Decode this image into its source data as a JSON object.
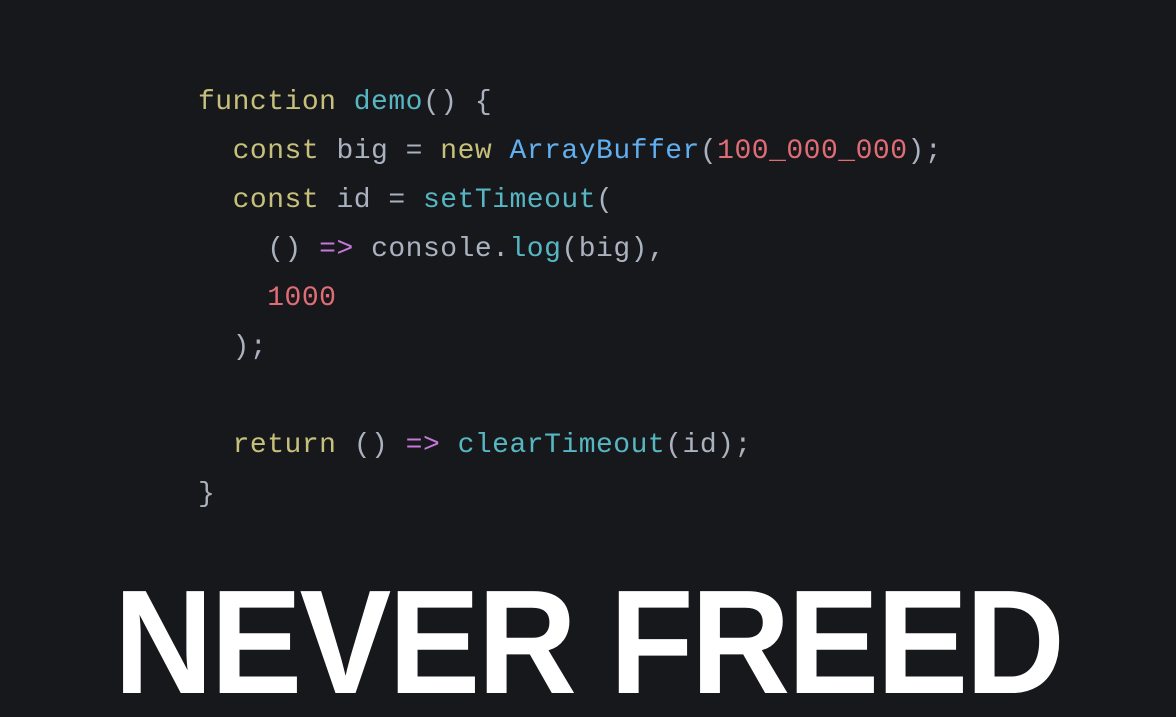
{
  "code": {
    "lines": [
      {
        "indent": 0,
        "tokens": [
          {
            "t": "function ",
            "c": "tok-keyword"
          },
          {
            "t": "demo",
            "c": "tok-func-name"
          },
          {
            "t": "() {",
            "c": "tok-punct"
          }
        ]
      },
      {
        "indent": 1,
        "tokens": [
          {
            "t": "const ",
            "c": "tok-keyword"
          },
          {
            "t": "big",
            "c": "tok-var-decl"
          },
          {
            "t": " ",
            "c": "tok-punct"
          },
          {
            "t": "=",
            "c": "tok-operator"
          },
          {
            "t": " ",
            "c": "tok-punct"
          },
          {
            "t": "new ",
            "c": "tok-keyword"
          },
          {
            "t": "ArrayBuffer",
            "c": "tok-class"
          },
          {
            "t": "(",
            "c": "tok-punct"
          },
          {
            "t": "100_000_000",
            "c": "tok-number"
          },
          {
            "t": ");",
            "c": "tok-punct"
          }
        ]
      },
      {
        "indent": 1,
        "tokens": [
          {
            "t": "const ",
            "c": "tok-keyword"
          },
          {
            "t": "id",
            "c": "tok-var-decl"
          },
          {
            "t": " ",
            "c": "tok-punct"
          },
          {
            "t": "=",
            "c": "tok-operator"
          },
          {
            "t": " ",
            "c": "tok-punct"
          },
          {
            "t": "setTimeout",
            "c": "tok-call"
          },
          {
            "t": "(",
            "c": "tok-punct"
          }
        ]
      },
      {
        "indent": 2,
        "tokens": [
          {
            "t": "() ",
            "c": "tok-punct"
          },
          {
            "t": "=>",
            "c": "tok-arrow"
          },
          {
            "t": " ",
            "c": "tok-punct"
          },
          {
            "t": "console",
            "c": "tok-object"
          },
          {
            "t": ".",
            "c": "tok-punct"
          },
          {
            "t": "log",
            "c": "tok-call"
          },
          {
            "t": "(",
            "c": "tok-punct"
          },
          {
            "t": "big",
            "c": "tok-var-use"
          },
          {
            "t": "),",
            "c": "tok-punct"
          }
        ]
      },
      {
        "indent": 2,
        "tokens": [
          {
            "t": "1000",
            "c": "tok-number"
          }
        ]
      },
      {
        "indent": 1,
        "tokens": [
          {
            "t": ");",
            "c": "tok-punct"
          }
        ]
      },
      {
        "indent": 0,
        "tokens": []
      },
      {
        "indent": 1,
        "tokens": [
          {
            "t": "return ",
            "c": "tok-keyword"
          },
          {
            "t": "() ",
            "c": "tok-punct"
          },
          {
            "t": "=>",
            "c": "tok-arrow"
          },
          {
            "t": " ",
            "c": "tok-punct"
          },
          {
            "t": "clearTimeout",
            "c": "tok-call"
          },
          {
            "t": "(",
            "c": "tok-punct"
          },
          {
            "t": "id",
            "c": "tok-var-use"
          },
          {
            "t": ");",
            "c": "tok-punct"
          }
        ]
      },
      {
        "indent": 0,
        "tokens": [
          {
            "t": "}",
            "c": "tok-punct"
          }
        ]
      }
    ]
  },
  "caption": "NEVER FREED"
}
